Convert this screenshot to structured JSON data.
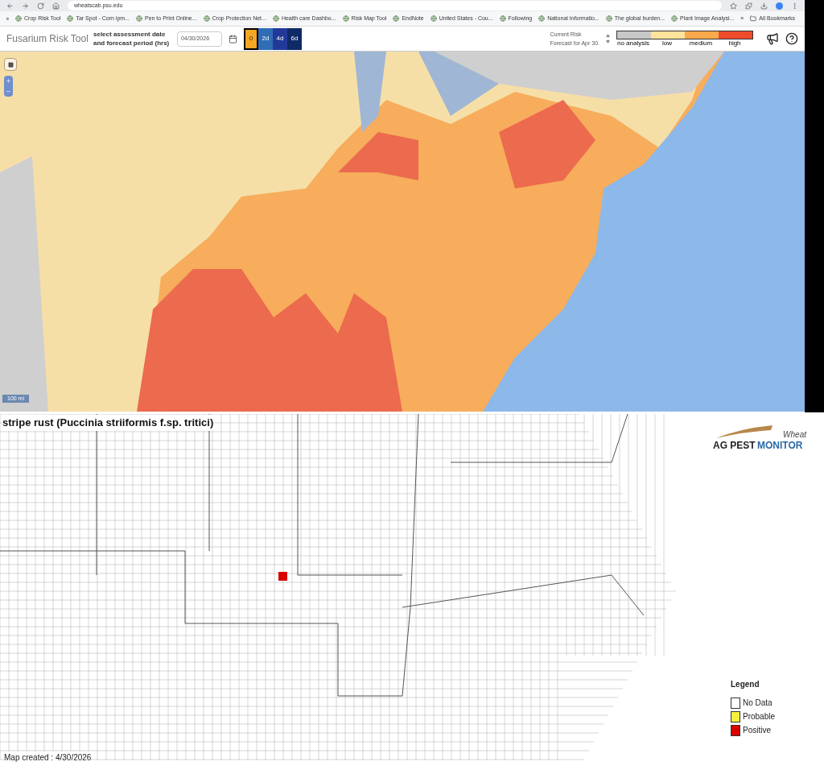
{
  "browser": {
    "url": "wheatscab.psu.edu",
    "bookmarks": [
      "Crop Risk Tool",
      "Tar Spot - Corn ipm...",
      "Pen to Print Online...",
      "Crop Protection Net...",
      "Health care Dashbo...",
      "Risk Map Tool",
      "EndNote",
      "United States - Cou...",
      "Following",
      "National Informatio...",
      "The global burden...",
      "Plant Image Analysi..."
    ],
    "more": "»",
    "all_bookmarks": "All Bookmarks"
  },
  "tool": {
    "title": "Fusarium Risk Tool",
    "date_label": "select assessment date and forecast period (hrs)",
    "date": "04/30/2026",
    "periods": [
      {
        "label": "0",
        "selected": true,
        "color": "#f5a623"
      },
      {
        "label": "2d",
        "selected": false,
        "color": "#2f6db5"
      },
      {
        "label": "4d",
        "selected": false,
        "color": "#23399a"
      },
      {
        "label": "6d",
        "selected": false,
        "color": "#0f2a66"
      }
    ],
    "risk_title": "Current Risk",
    "risk_subtitle": "Forecast for Apr 30.",
    "risk_legend": [
      {
        "label": "no analysis",
        "color": "#c8c8c8"
      },
      {
        "label": "low",
        "color": "#fde49a"
      },
      {
        "label": "medium",
        "color": "#f9a94b"
      },
      {
        "label": "high",
        "color": "#ee4b2b"
      }
    ],
    "scale": "100 mi"
  },
  "pest_map": {
    "title": "stripe rust (Puccinia striiformis f.sp. tritici)",
    "logo": {
      "top": "Wheat",
      "left": "AG PEST",
      "right": "MONITOR"
    },
    "legend_title": "Legend",
    "legend": [
      {
        "label": "No Data",
        "color": "#ffffff"
      },
      {
        "label": "Probable",
        "color": "#f7ef3c"
      },
      {
        "label": "Positive",
        "color": "#d90000"
      }
    ],
    "created": "Map created : 4/30/2026"
  }
}
